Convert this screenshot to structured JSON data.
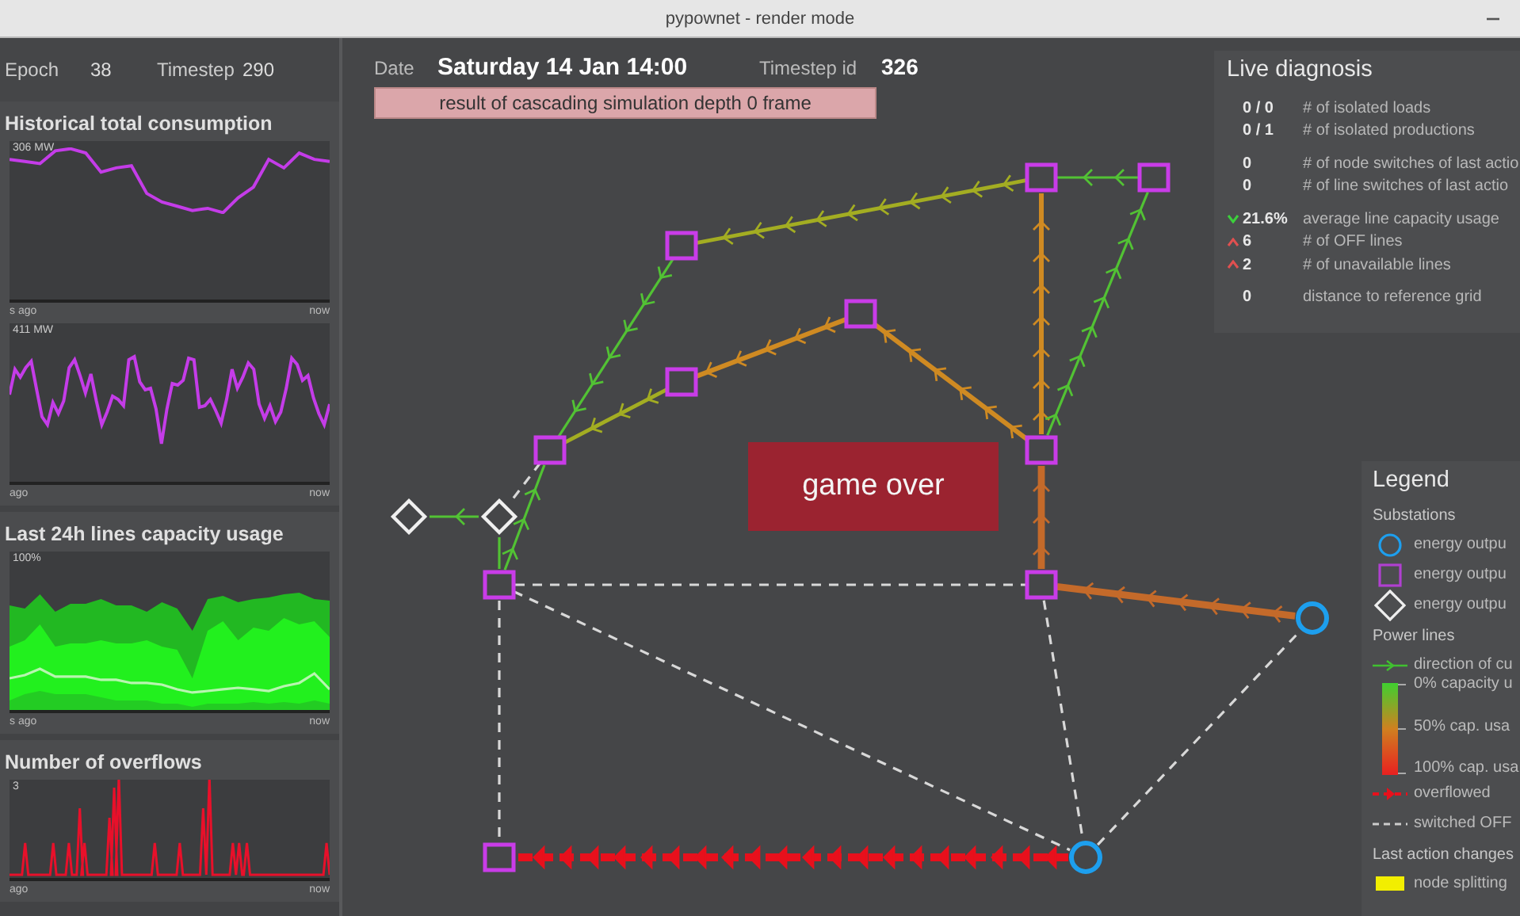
{
  "window": {
    "title": "pypownet - render mode"
  },
  "sidebar": {
    "epoch_label": "Epoch",
    "epoch": "38",
    "timestep_label": "Timestep",
    "timestep": "290",
    "panels": [
      {
        "kind": "consumption",
        "title": "Historical total consumption",
        "charts": [
          {
            "top_label": "306 MW",
            "left_axis": "s ago",
            "right_axis": "now"
          },
          {
            "top_label": "411 MW",
            "left_axis": "ago",
            "right_axis": "now"
          }
        ]
      },
      {
        "kind": "capacity",
        "title": "Last 24h lines capacity usage",
        "charts": [
          {
            "top_label": "100%",
            "left_axis": "s ago",
            "right_axis": "now"
          }
        ]
      },
      {
        "kind": "overflows",
        "title": "Number of overflows",
        "charts": [
          {
            "top_label": "3",
            "left_axis": "ago",
            "right_axis": "now"
          }
        ]
      }
    ]
  },
  "header": {
    "date_label": "Date",
    "date": "Saturday 14 Jan  14:00",
    "timestep_id_label": "Timestep id",
    "timestep_id": "326",
    "banner": "result of cascading simulation depth 0 frame"
  },
  "grid": {
    "game_over": "game over",
    "nodes": [
      {
        "kind": "square"
      },
      {
        "kind": "square"
      },
      {
        "kind": "square"
      },
      {
        "kind": "square"
      },
      {
        "kind": "square"
      },
      {
        "kind": "square"
      },
      {
        "kind": "square"
      },
      {
        "kind": "diamond"
      },
      {
        "kind": "diamond"
      },
      {
        "kind": "square"
      },
      {
        "kind": "square"
      },
      {
        "kind": "circle"
      },
      {
        "kind": "square"
      },
      {
        "kind": "circle"
      }
    ],
    "lines": [
      {
        "kind": "light"
      },
      {
        "kind": "moderate"
      },
      {
        "kind": "light"
      },
      {
        "kind": "moderate"
      },
      {
        "kind": "heavy"
      },
      {
        "kind": "heavy"
      },
      {
        "kind": "heavy"
      },
      {
        "kind": "light"
      },
      {
        "kind": "full"
      },
      {
        "kind": "full"
      },
      {
        "kind": "light"
      },
      {
        "kind": "light"
      },
      {
        "kind": "light"
      },
      {
        "kind": "off"
      },
      {
        "kind": "off"
      },
      {
        "kind": "off"
      },
      {
        "kind": "off"
      },
      {
        "kind": "off"
      },
      {
        "kind": "off"
      },
      {
        "kind": "overflowed"
      }
    ]
  },
  "diagnosis": {
    "title": "Live diagnosis",
    "groups": [
      [
        {
          "kind": "plain",
          "value": "0 / 0",
          "label": "# of isolated loads"
        },
        {
          "kind": "plain",
          "value": "0 / 1",
          "label": "# of isolated productions"
        }
      ],
      [
        {
          "kind": "plain",
          "value": "0",
          "label": "# of node switches of last actio"
        },
        {
          "kind": "plain",
          "value": "0",
          "label": "# of line switches of last actio"
        }
      ],
      [
        {
          "kind": "good",
          "value": "21.6%",
          "label": "average line capacity usage"
        },
        {
          "kind": "bad",
          "value": "6",
          "label": "# of OFF lines"
        },
        {
          "kind": "bad",
          "value": "2",
          "label": "# of unavailable lines"
        }
      ],
      [
        {
          "kind": "plain",
          "value": "0",
          "label": "distance to reference grid"
        }
      ]
    ]
  },
  "legend": {
    "title": "Legend",
    "sections": [
      {
        "title": "Substations",
        "items": [
          {
            "kind": "circle",
            "label": "energy outpu"
          },
          {
            "kind": "square",
            "label": "energy outpu"
          },
          {
            "kind": "diamond",
            "label": "energy outpu"
          }
        ]
      },
      {
        "title": "Power lines",
        "items": [
          {
            "kind": "arrow",
            "label": "direction of cu"
          },
          {
            "kind": "gradient",
            "labels": [
              "0% capacity u",
              "50% cap. usa",
              "100% cap. usa"
            ]
          },
          {
            "kind": "overflowed",
            "label": "overflowed"
          },
          {
            "kind": "off",
            "label": "switched OFF"
          }
        ]
      },
      {
        "title": "Last action changes",
        "items": [
          {
            "kind": "swatch",
            "color": "#f2ee00",
            "label": "node splitting"
          }
        ]
      }
    ]
  }
}
